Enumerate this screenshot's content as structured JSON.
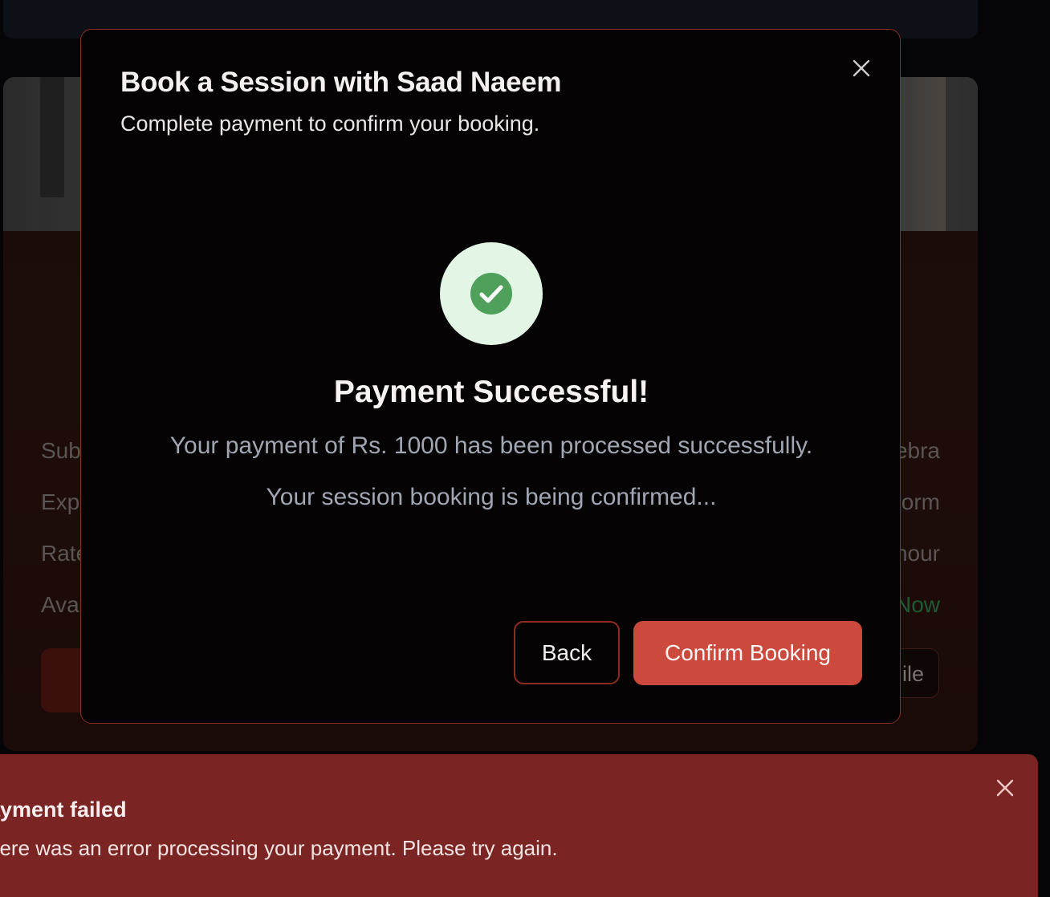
{
  "background": {
    "rows": [
      {
        "label": "Sub",
        "value": "ebra",
        "value_color": "#5a5553"
      },
      {
        "label": "Exp",
        "value": "orm",
        "value_color": "#5a5553"
      },
      {
        "label": "Rate",
        "value": "hour",
        "value_color": "#5a5553"
      },
      {
        "label": "Ava",
        "value": "Now",
        "value_color": "#1e5a34"
      }
    ],
    "secondary_button_label": "ile"
  },
  "modal": {
    "title": "Book a Session with Saad Naeem",
    "subtitle": "Complete payment to confirm your booking.",
    "close_icon": "close-icon",
    "success": {
      "icon": "check-circle-icon",
      "heading": "Payment Successful!",
      "line1": "Your payment of Rs. 1000 has been processed successfully.",
      "line2": "Your session booking is being confirmed..."
    },
    "buttons": {
      "back_label": "Back",
      "confirm_label": "Confirm Booking"
    }
  },
  "toast": {
    "title": "ayment failed",
    "message": "here was an error processing your payment. Please try again.",
    "close_icon": "close-icon"
  },
  "colors": {
    "accent": "#cc4a3d",
    "modal_border": "#8a2d22",
    "success_bg": "#e3f6e6",
    "success_icon": "#4ea05a",
    "toast_bg": "#7a2423"
  }
}
